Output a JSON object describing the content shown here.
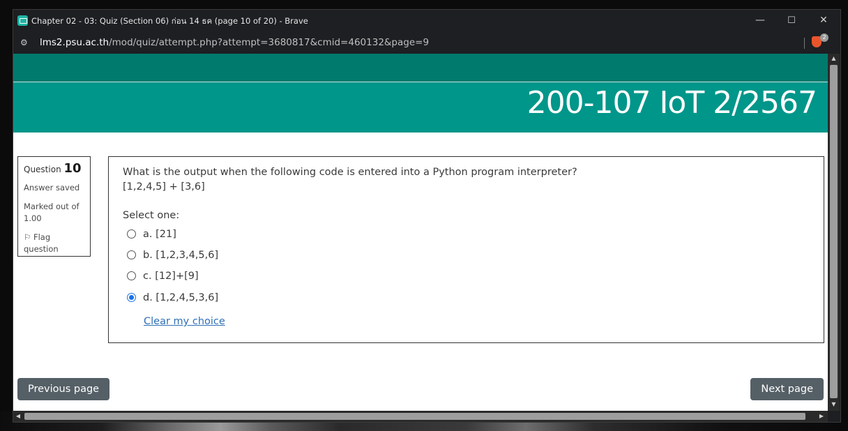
{
  "window": {
    "title": "Chapter 02 - 03: Quiz (Section 06) ก่อน 14 ธค (page 10 of 20) - Brave",
    "minimize": "—",
    "maximize": "☐",
    "close": "✕"
  },
  "address": {
    "host": "lms2.psu.ac.th",
    "path": "/mod/quiz/attempt.php?attempt=3680817&cmid=460132&page=9",
    "site_info_icon": "tune-icon",
    "shield_count": "2"
  },
  "colors": {
    "banner_dark": "#007a6d",
    "banner": "#00968a",
    "nav_button": "#555f66",
    "link": "#2f6fb6",
    "radio_checked": "#1a73e8"
  },
  "course": {
    "title": "200-107 IoT 2/2567"
  },
  "question_info": {
    "label": "Question",
    "number": "10",
    "state": "Answer saved",
    "grade": "Marked out of 1.00",
    "flag_icon": "flag-icon",
    "flag_label": "Flag question"
  },
  "question": {
    "text_line1": "What is the output when the following code is entered into a Python program interpreter?",
    "text_line2": "[1,2,4,5] + [3,6]",
    "prompt": "Select one:",
    "options": [
      {
        "label": "a. [21]",
        "selected": false
      },
      {
        "label": "b. [1,2,3,4,5,6]",
        "selected": false
      },
      {
        "label": "c. [12]+[9]",
        "selected": false
      },
      {
        "label": "d. [1,2,4,5,3,6]",
        "selected": true
      }
    ],
    "clear_link": "Clear my choice"
  },
  "navigation": {
    "previous": "Previous page",
    "next": "Next page"
  }
}
